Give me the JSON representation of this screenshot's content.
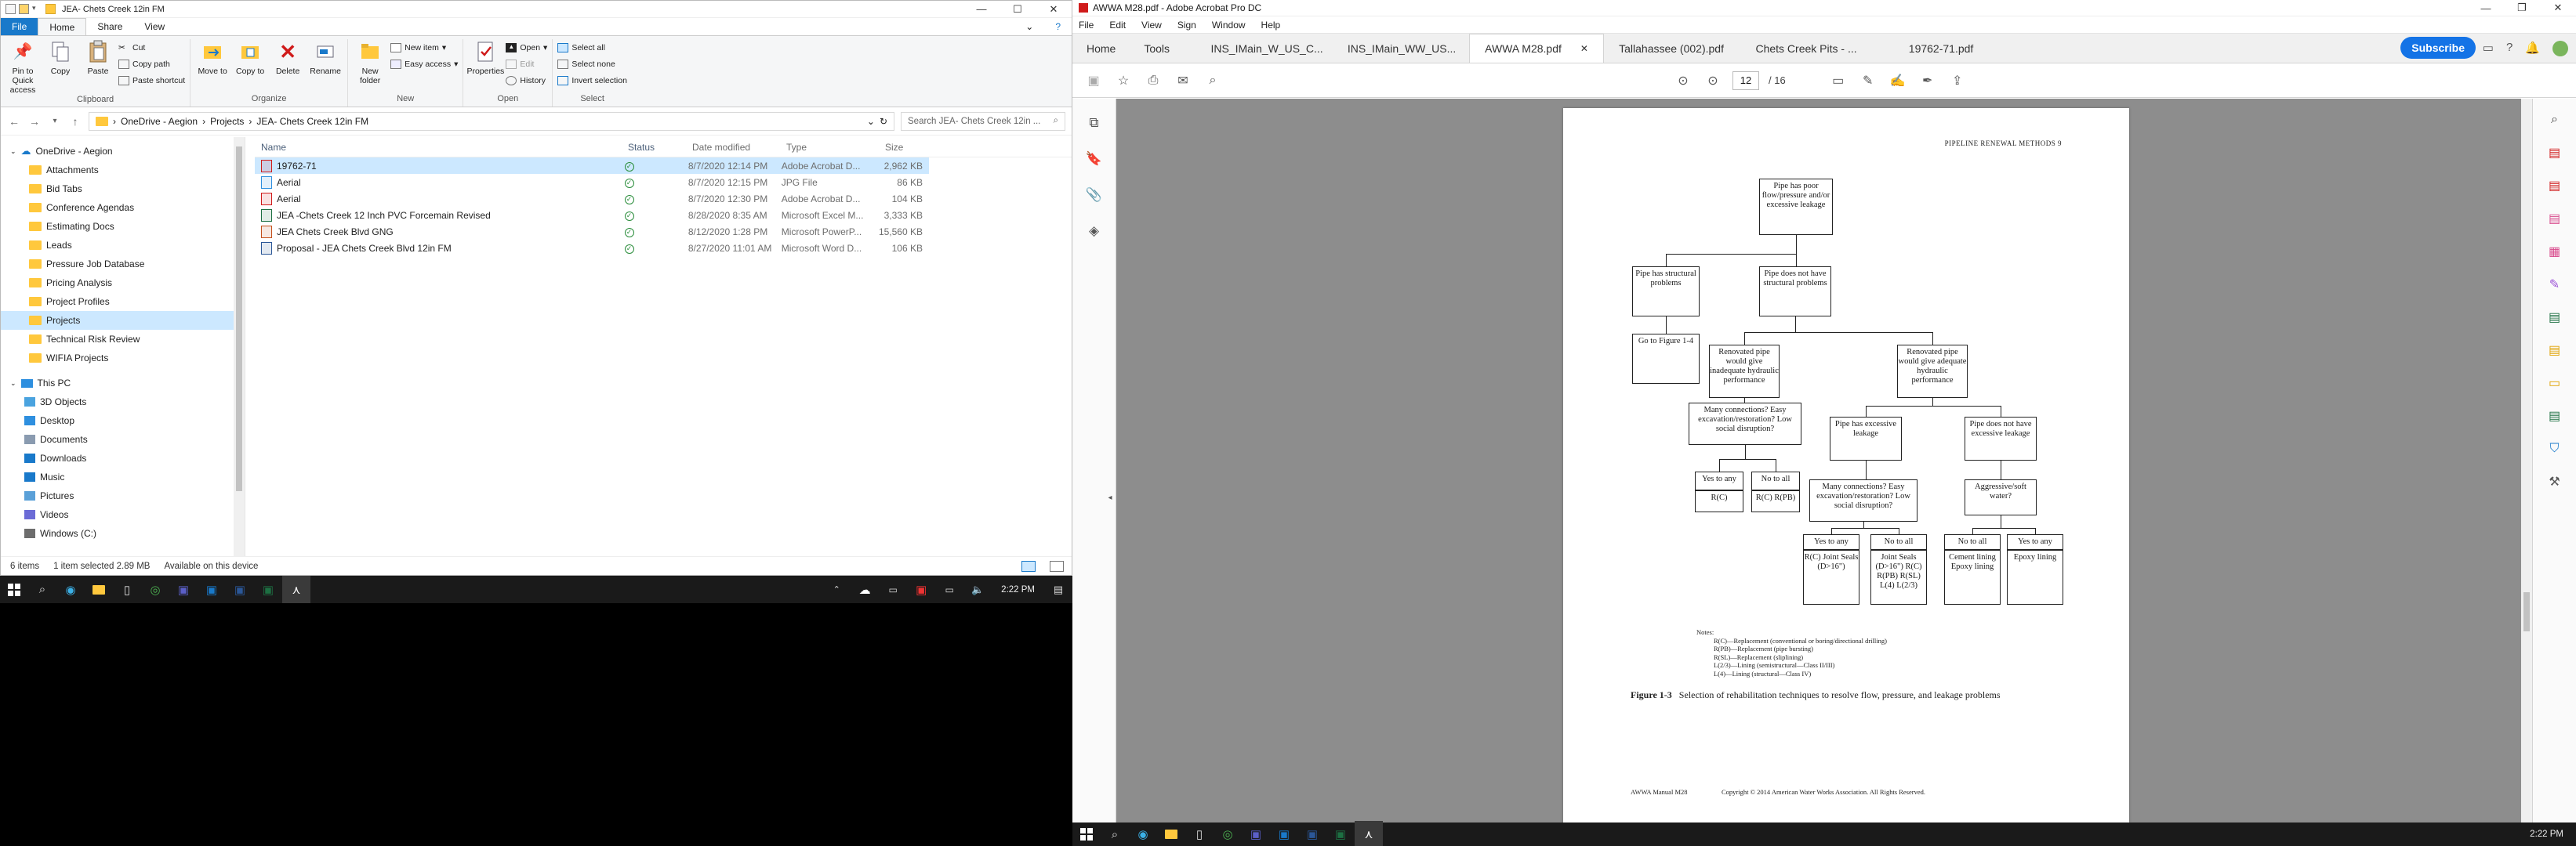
{
  "explorer": {
    "title": "JEA- Chets Creek 12in FM",
    "tabs": [
      "File",
      "Home",
      "Share",
      "View"
    ],
    "ribbon": {
      "clipboard": {
        "label": "Clipboard",
        "pin": "Pin to Quick access",
        "copy": "Copy",
        "paste": "Paste",
        "cut": "Cut",
        "copy_path": "Copy path",
        "paste_shortcut": "Paste shortcut"
      },
      "organize": {
        "label": "Organize",
        "move_to": "Move to",
        "copy_to": "Copy to",
        "delete": "Delete",
        "rename": "Rename"
      },
      "new": {
        "label": "New",
        "new_folder": "New folder",
        "new_item": "New item",
        "easy_access": "Easy access"
      },
      "open": {
        "label": "Open",
        "properties": "Properties",
        "open": "Open",
        "edit": "Edit",
        "history": "History"
      },
      "select": {
        "label": "Select",
        "select_all": "Select all",
        "select_none": "Select none",
        "invert": "Invert selection"
      }
    },
    "breadcrumb": [
      "OneDrive - Aegion",
      "Projects",
      "JEA- Chets Creek 12in FM"
    ],
    "search_placeholder": "Search JEA- Chets Creek 12in ...",
    "nav": {
      "onedrive": "OneDrive - Aegion",
      "folders": [
        "Attachments",
        "Bid Tabs",
        "Conference Agendas",
        "Estimating Docs",
        "Leads",
        "Pressure Job Database",
        "Pricing Analysis",
        "Project Profiles",
        "Projects",
        "Technical Risk Review",
        "WIFIA Projects"
      ],
      "this_pc": "This PC",
      "pc_items": [
        "3D Objects",
        "Desktop",
        "Documents",
        "Downloads",
        "Music",
        "Pictures",
        "Videos",
        "Windows (C:)"
      ]
    },
    "columns": [
      "Name",
      "Status",
      "Date modified",
      "Type",
      "Size"
    ],
    "files": [
      {
        "name": "19762-71",
        "date": "8/7/2020 12:14 PM",
        "type": "Adobe Acrobat D...",
        "size": "2,962 KB",
        "kind": "pdf"
      },
      {
        "name": "Aerial",
        "date": "8/7/2020 12:15 PM",
        "type": "JPG File",
        "size": "86 KB",
        "kind": "jpg"
      },
      {
        "name": "Aerial",
        "date": "8/7/2020 12:30 PM",
        "type": "Adobe Acrobat D...",
        "size": "104 KB",
        "kind": "pdf"
      },
      {
        "name": "JEA -Chets Creek 12 Inch PVC Forcemain Revised",
        "date": "8/28/2020 8:35 AM",
        "type": "Microsoft Excel M...",
        "size": "3,333 KB",
        "kind": "xls"
      },
      {
        "name": "JEA Chets Creek Blvd GNG",
        "date": "8/12/2020 1:28 PM",
        "type": "Microsoft PowerP...",
        "size": "15,560 KB",
        "kind": "ppt"
      },
      {
        "name": "Proposal - JEA Chets Creek Blvd 12in FM",
        "date": "8/27/2020 11:01 AM",
        "type": "Microsoft Word D...",
        "size": "106 KB",
        "kind": "doc"
      }
    ],
    "status": {
      "items": "6 items",
      "selected": "1 item selected  2.89 MB",
      "availability": "Available on this device"
    }
  },
  "taskbar_left": {
    "time": "2:22 PM"
  },
  "acrobat": {
    "title": "AWWA M28.pdf - Adobe Acrobat Pro DC",
    "menu": [
      "File",
      "Edit",
      "View",
      "Sign",
      "Window",
      "Help"
    ],
    "nav_tabs": [
      "Home",
      "Tools"
    ],
    "doc_tabs": [
      "INS_IMain_W_US_C...",
      "INS_IMain_WW_US...",
      "AWWA M28.pdf",
      "Tallahassee (002).pdf",
      "Chets Creek Pits - ...",
      "19762-71.pdf"
    ],
    "active_tab": 2,
    "subscribe": "Subscribe",
    "page_current": "12",
    "page_total": "/ 16",
    "time": "2:22 PM"
  },
  "pdf": {
    "header": "PIPELINE RENEWAL METHODS  9",
    "boxes": {
      "root": "Pipe has poor flow/pressure and/or excessive leakage",
      "struct": "Pipe has structural problems",
      "nostruct": "Pipe does not have structural problems",
      "goto": "Go to Figure 1-4",
      "inadequate": "Renovated pipe would give inadequate hydraulic performance",
      "adequate": "Renovated pipe would give adequate hydraulic performance",
      "many1": "Many connections? Easy excavation/restoration? Low social disruption?",
      "excessive": "Pipe has excessive leakage",
      "notexcessive": "Pipe does not have excessive leakage",
      "yes1": "Yes to any",
      "no1": "No to all",
      "r1": "R(C)",
      "r2": "R(C) R(PB)",
      "many2": "Many connections? Easy excavation/restoration? Low social disruption?",
      "aggressive": "Aggressive/soft water?",
      "yes2": "Yes to any",
      "no2": "No to all",
      "no3": "No to all",
      "yes3": "Yes to any",
      "out1": "R(C) Joint Seals (D>16\")",
      "out2": "Joint Seals (D>16\") R(C) R(PB) R(SL) L(4) L(2/3)",
      "out3": "Cement lining Epoxy lining",
      "out4": "Epoxy lining"
    },
    "notes_title": "Notes:",
    "notes": [
      "R(C)—Replacement (conventional or boring/directional drilling)",
      "R(PB)—Replacement (pipe bursting)",
      "R(SL)—Replacement (sliplining)",
      "L(2/3)—Lining (semistructural—Class II/III)",
      "L(4)—Lining (structural—Class IV)"
    ],
    "caption_num": "Figure 1-3",
    "caption": "Selection of rehabilitation techniques to resolve flow, pressure, and leakage problems",
    "footer_left": "AWWA Manual M28",
    "footer_right": "Copyright © 2014 American Water Works Association. All Rights Reserved."
  }
}
